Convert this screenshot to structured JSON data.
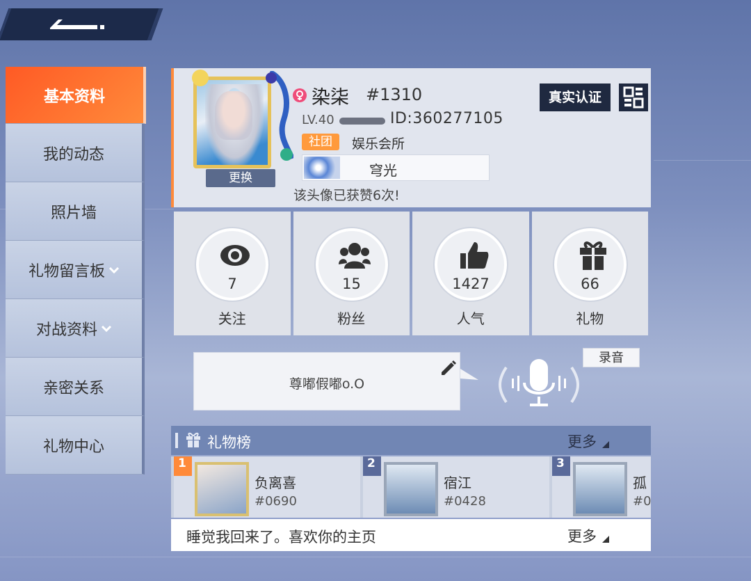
{
  "sidebar": {
    "items": [
      {
        "label": "基本资料"
      },
      {
        "label": "我的动态"
      },
      {
        "label": "照片墙"
      },
      {
        "label": "礼物留言板"
      },
      {
        "label": "对战资料"
      },
      {
        "label": "亲密关系"
      },
      {
        "label": "礼物中心"
      }
    ]
  },
  "profile": {
    "change_label": "更换",
    "name": "染柒",
    "tag": "#1310",
    "level": "LV.40",
    "id": "ID:360277105",
    "club_badge": "社团",
    "club_name": "娱乐会所",
    "title": "穹光",
    "likes_text": "该头像已获赞6次!",
    "verify_label": "真实认证"
  },
  "stats": [
    {
      "value": "7",
      "label": "关注",
      "icon": "eye-icon"
    },
    {
      "value": "15",
      "label": "粉丝",
      "icon": "fans-icon"
    },
    {
      "value": "1427",
      "label": "人气",
      "icon": "thumbs-up-icon"
    },
    {
      "value": "66",
      "label": "礼物",
      "icon": "gift-icon"
    }
  ],
  "signature": {
    "text": "尊嘟假嘟o.O",
    "record_label": "录音"
  },
  "gift_ranking": {
    "title": "礼物榜",
    "more_label": "更多",
    "items": [
      {
        "rank": "1",
        "name": "负离喜",
        "tag": "#0690"
      },
      {
        "rank": "2",
        "name": "宿江",
        "tag": "#0428"
      },
      {
        "rank": "3",
        "name": "孤",
        "tag": "#0"
      }
    ]
  },
  "comment": {
    "text": "睡觉我回来了。喜欢你的主页",
    "more_label": "更多"
  },
  "colors": {
    "accent": "#ff6a2c",
    "dark": "#1f2940",
    "bar": "#7186b4"
  }
}
